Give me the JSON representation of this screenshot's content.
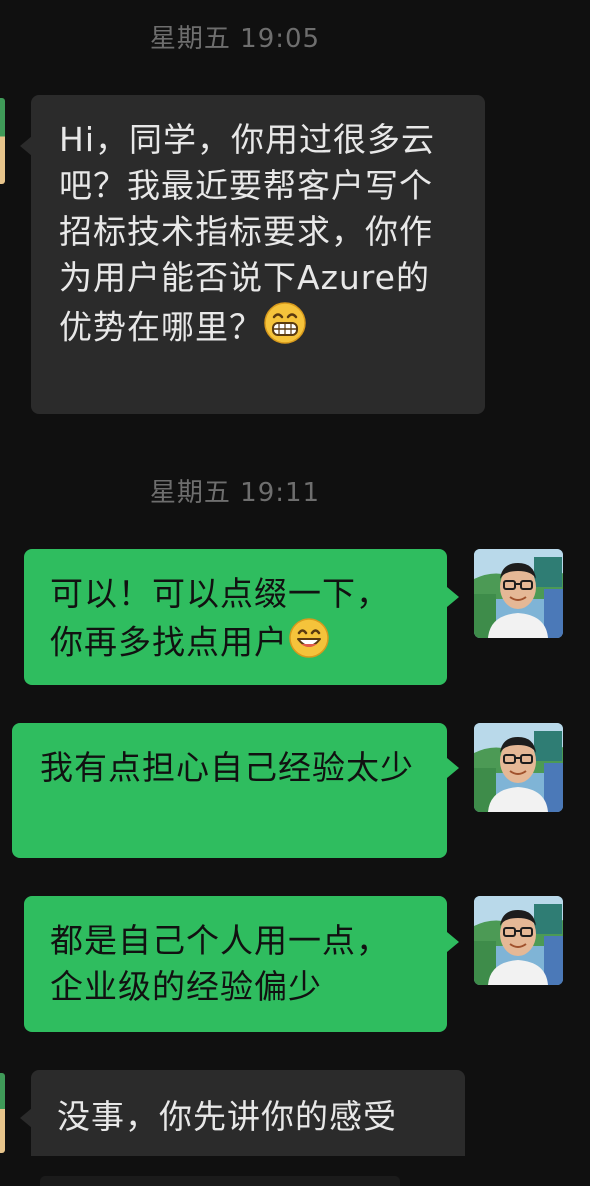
{
  "timestamps": [
    "星期五 19:05",
    "星期五 19:11"
  ],
  "messages": [
    {
      "side": "left",
      "text": "Hi，同学，你用过很多云吧？我最近要帮客户写个招标技术指标要求，你作为用户能否说下Azure的优势在哪里？",
      "emoji": "grin-emoji"
    },
    {
      "side": "right",
      "text": "可以！可以点缀一下，你再多找点用户",
      "emoji": "smile-emoji"
    },
    {
      "side": "right",
      "text": "我有点担心自己经验太少"
    },
    {
      "side": "right",
      "text": "都是自己个人用一点，企业级的经验偏少"
    },
    {
      "side": "left",
      "text": "没事，你先讲你的感受"
    }
  ],
  "colors": {
    "background": "#101010",
    "incoming_bubble": "#2b2b2b",
    "outgoing_bubble": "#2fbd5f",
    "timestamp_text": "#6e6e6e"
  }
}
